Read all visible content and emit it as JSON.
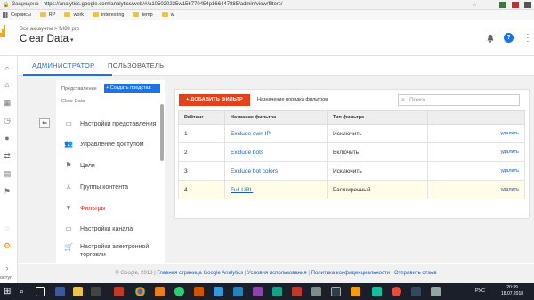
{
  "browser": {
    "security_label": "Защищено",
    "url": "https://analytics.google.com/analytics/web/#/a105020235w156770454p166447885/admin/view/filters/",
    "bookmarks": [
      {
        "label": "Сервисы"
      },
      {
        "label": "RP"
      },
      {
        "label": "work"
      },
      {
        "label": "interesting"
      },
      {
        "label": "temp"
      },
      {
        "label": "w"
      }
    ]
  },
  "header": {
    "breadcrumb": "Все аккаунты > fvl80 pro",
    "view_title": "Clear Data",
    "help_badge": "?"
  },
  "tabs": {
    "admin": "АДМИНИСТРАТОР",
    "user": "ПОЛЬЗОВАТЕЛЬ"
  },
  "admin_nav": {
    "section_label": "Представление",
    "create_button": "+ Создать представ",
    "view_name": "Clear Data",
    "items": [
      {
        "label": "Настройки представления",
        "icon": "view-settings-icon"
      },
      {
        "label": "Управление доступом",
        "icon": "people-icon"
      },
      {
        "label": "Цели",
        "icon": "flag-icon"
      },
      {
        "label": "Группы контента",
        "icon": "content-groups-icon"
      },
      {
        "label": "Фильтры",
        "icon": "filter-icon",
        "active": true
      },
      {
        "label": "Настройки канала",
        "icon": "channel-icon"
      },
      {
        "label": "Настройки электронной торговли",
        "icon": "cart-icon"
      }
    ]
  },
  "filters": {
    "add_button": "+ ДОБАВИТЬ ФИЛЬТР",
    "order_link": "Назначение порядка фильтров",
    "search_placeholder": "Поиск",
    "columns": [
      "Рейтинг",
      "Название фильтра",
      "Тип фильтра"
    ],
    "rows": [
      {
        "rank": "1",
        "name": "Exclude own IP",
        "type": "Исключить",
        "action": "удалить"
      },
      {
        "rank": "2",
        "name": "Exclude bots",
        "type": "Включить",
        "action": "удалить"
      },
      {
        "rank": "3",
        "name": "Exclude bot colors",
        "type": "Исключить",
        "action": "удалить"
      },
      {
        "rank": "4",
        "name": "Full URL",
        "type": "Расширенный",
        "action": "удалить"
      }
    ]
  },
  "footer": {
    "copyright": "© Google, 2018 |",
    "links": [
      "Главная страница Google Analytics",
      "Условия использования",
      "Политика конфиденциальности",
      "Отправить отзыв"
    ]
  },
  "status_text": "оступ",
  "taskbar": {
    "lang": "РУС",
    "time": "20:39",
    "date": "18.07.2018"
  },
  "colors": {
    "accent": "#1a73e8",
    "add_button": "#e0421b",
    "active_nav": "#d93025"
  }
}
